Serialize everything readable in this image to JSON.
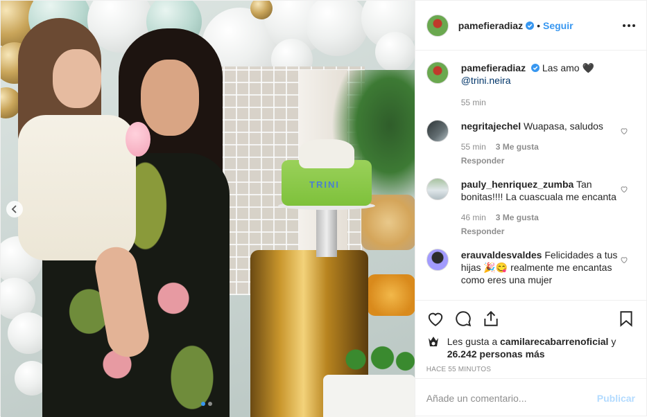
{
  "post": {
    "username": "pamefieradiaz",
    "follow_label": "Seguir",
    "separator": "•",
    "caption_text": "Las amo 🖤",
    "caption_mention": "@trini.neira",
    "caption_time": "55 min"
  },
  "photo": {
    "cake_text": "TRINI",
    "carousel_dots": 2,
    "active_dot": 1
  },
  "comments": [
    {
      "user": "negritajechel",
      "text": "Wuapasa, saludos",
      "time": "55 min",
      "likes": "3 Me gusta",
      "reply": "Responder"
    },
    {
      "user": "pauly_henriquez_zumba",
      "text": "Tan bonitas!!!! La cuascuala me encanta",
      "time": "46 min",
      "likes": "3 Me gusta",
      "reply": "Responder"
    },
    {
      "user": "erauvaldesvaldes",
      "text": "Felicidades a tus hijas 🎉😋 realmente me encantas como eres una mujer"
    }
  ],
  "likes": {
    "prefix": "Les gusta a",
    "user": "camilarecabarrenoficial",
    "conj": "y",
    "count": "26.242 personas más"
  },
  "time_ago": "HACE 55 MINUTOS",
  "add_comment": {
    "placeholder": "Añade un comentario...",
    "publish_label": "Publicar"
  },
  "colors": {
    "link": "#3897f0",
    "muted": "#8e8e8e",
    "publish_disabled": "#b3dbff"
  },
  "icons": [
    "heart-icon",
    "comment-icon",
    "share-icon",
    "bookmark-icon",
    "more-icon",
    "verified-icon",
    "chevron-left-icon"
  ]
}
